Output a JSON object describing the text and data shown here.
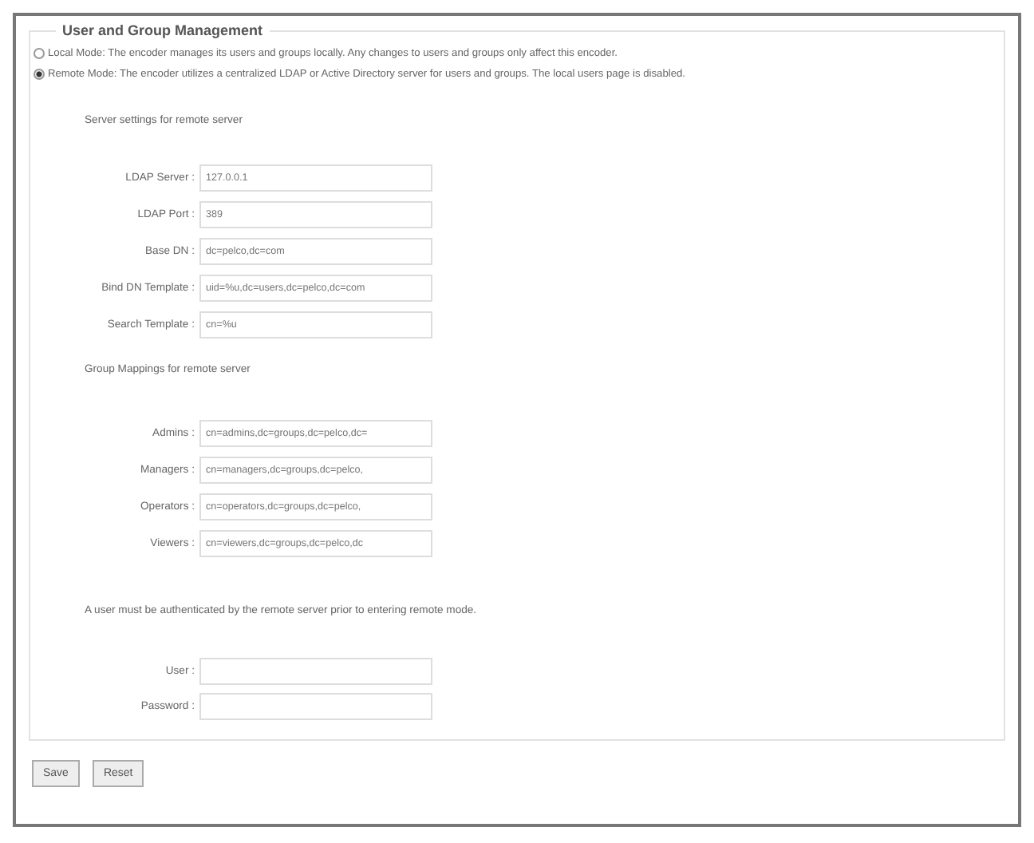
{
  "section": {
    "title": "User and Group Management"
  },
  "modes": [
    {
      "label": "Local Mode: The encoder manages its users and groups locally. Any changes to users and groups only affect this encoder.",
      "selected": false
    },
    {
      "label": "Remote Mode: The encoder utilizes a centralized LDAP or Active Directory server for users and groups. The local users page is disabled.",
      "selected": true
    }
  ],
  "server_settings": {
    "heading": "Server settings for remote server",
    "fields": [
      {
        "label": "LDAP Server :",
        "value": "127.0.0.1"
      },
      {
        "label": "LDAP Port :",
        "value": "389"
      },
      {
        "label": "Base DN :",
        "value": "dc=pelco,dc=com"
      },
      {
        "label": "Bind DN Template :",
        "value": "uid=%u,dc=users,dc=pelco,dc=com"
      },
      {
        "label": "Search Template :",
        "value": "cn=%u"
      }
    ]
  },
  "group_mappings": {
    "heading": "Group Mappings for remote server",
    "fields": [
      {
        "label": "Admins :",
        "value": "cn=admins,dc=groups,dc=pelco,dc="
      },
      {
        "label": "Managers :",
        "value": "cn=managers,dc=groups,dc=pelco,"
      },
      {
        "label": "Operators :",
        "value": "cn=operators,dc=groups,dc=pelco,"
      },
      {
        "label": "Viewers :",
        "value": "cn=viewers,dc=groups,dc=pelco,dc"
      }
    ]
  },
  "authentication": {
    "note": "A user must be authenticated by the remote server prior to entering remote mode.",
    "fields": [
      {
        "label": "User :"
      },
      {
        "label": "Password :"
      }
    ]
  },
  "buttons": [
    "Save",
    "Reset"
  ]
}
